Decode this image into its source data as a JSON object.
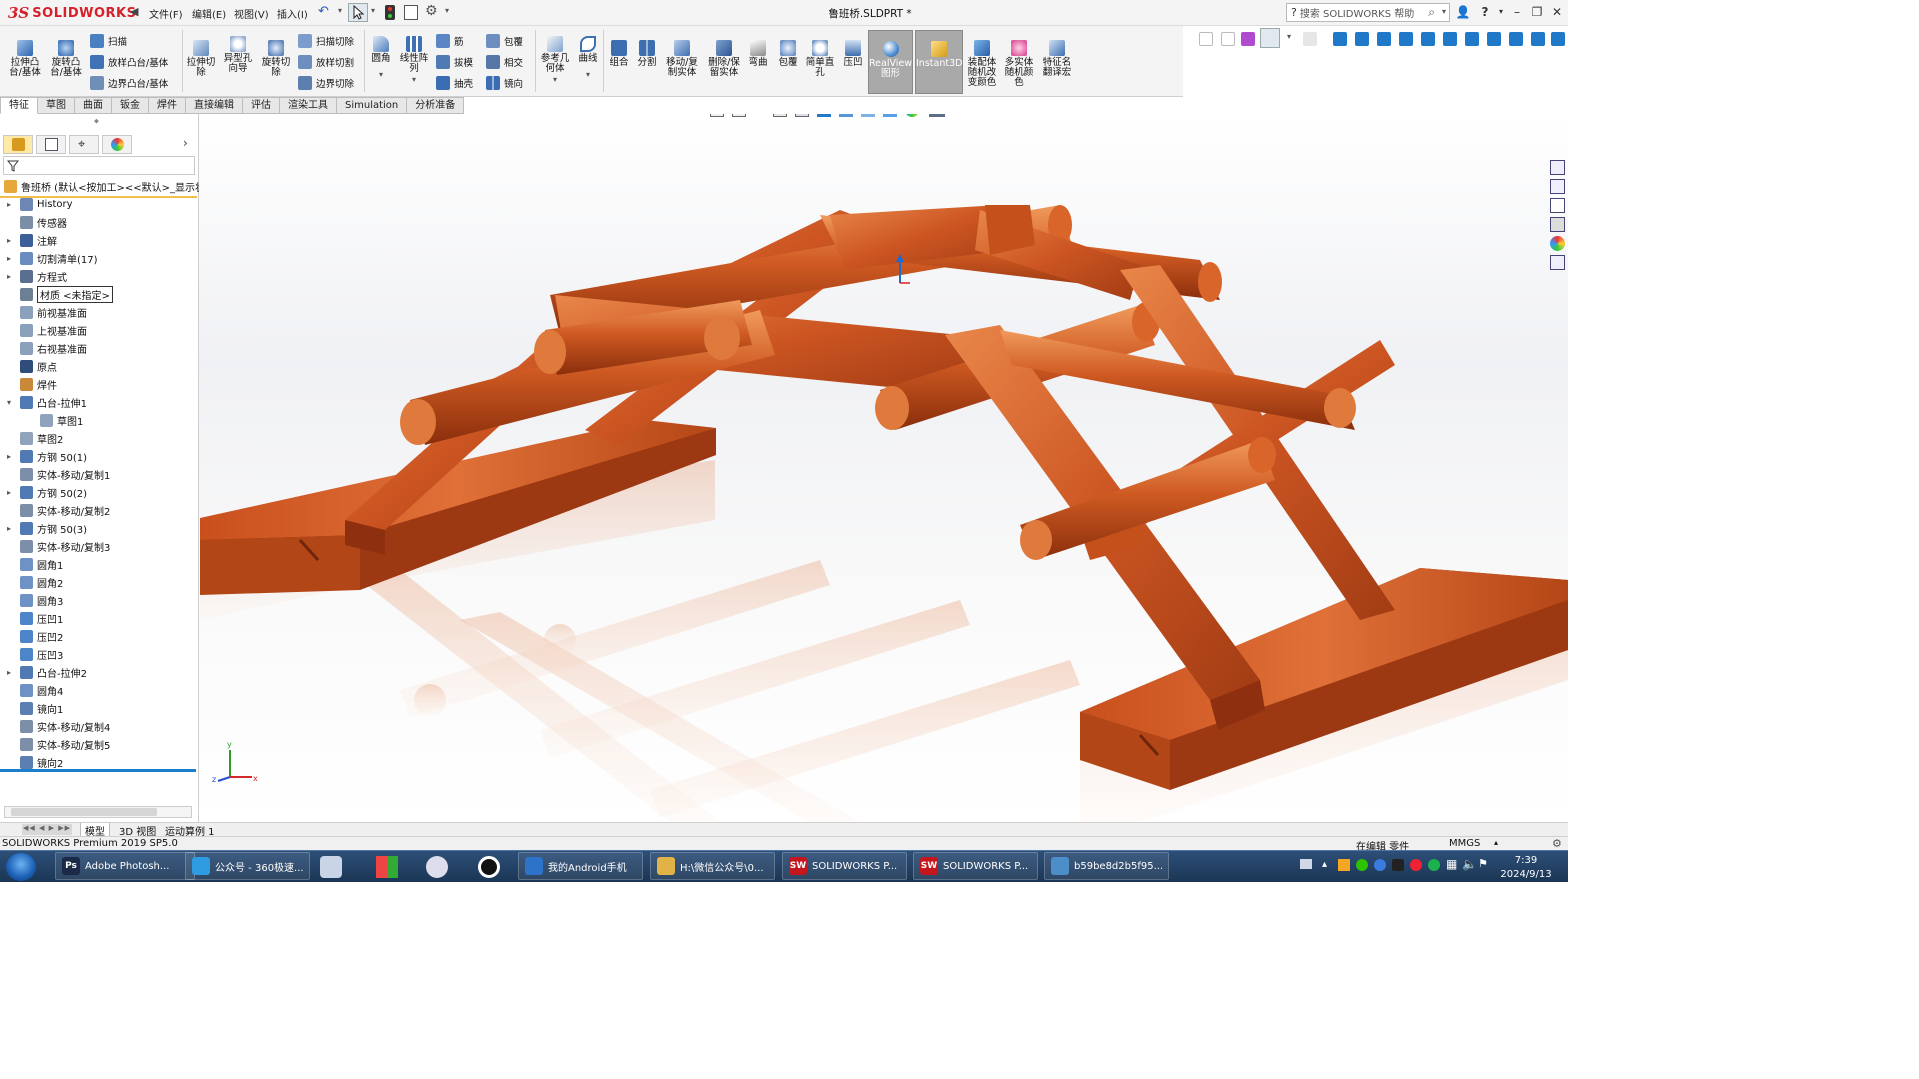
{
  "app": {
    "brand": "SOLIDWORKS",
    "doc_title": "鲁班桥.SLDPRT *"
  },
  "menu": [
    "文件(F)",
    "编辑(E)",
    "视图(V)",
    "插入(I)"
  ],
  "help": {
    "search_placeholder": "搜索 SOLIDWORKS 帮助"
  },
  "command_manager": {
    "big": [
      {
        "label": "拉伸凸\n台/基体",
        "icon": "extrude-boss-icon"
      },
      {
        "label": "旋转凸\n台/基体",
        "icon": "revolve-boss-icon"
      }
    ],
    "small_left": [
      {
        "label": "扫描",
        "icon": "sweep-icon"
      },
      {
        "label": "放样凸台/基体",
        "icon": "loft-icon"
      },
      {
        "label": "边界凸台/基体",
        "icon": "boundary-boss-icon"
      }
    ],
    "cut_big": [
      {
        "label": "拉伸切\n除",
        "icon": "extrude-cut-icon"
      },
      {
        "label": "异型孔\n向导",
        "icon": "hole-wizard-icon"
      },
      {
        "label": "旋转切\n除",
        "icon": "revolve-cut-icon"
      }
    ],
    "cut_small": [
      {
        "label": "扫描切除",
        "icon": "swept-cut-icon"
      },
      {
        "label": "放样切割",
        "icon": "lofted-cut-icon"
      },
      {
        "label": "边界切除",
        "icon": "boundary-cut-icon"
      }
    ],
    "fillet": {
      "label": "圆角",
      "icon": "fillet-icon"
    },
    "pattern": {
      "label": "线性阵\n列",
      "icon": "linear-pattern-icon"
    },
    "mid_small": [
      {
        "label": "筋",
        "icon": "rib-icon"
      },
      {
        "label": "拔模",
        "icon": "draft-icon"
      },
      {
        "label": "抽壳",
        "icon": "shell-icon"
      },
      {
        "label": "包覆",
        "icon": "wrap-icon"
      },
      {
        "label": "相交",
        "icon": "intersect-icon"
      },
      {
        "label": "镜向",
        "icon": "mirror-icon"
      }
    ],
    "right_big": [
      {
        "label": "参考几\n何体",
        "icon": "reference-geometry-icon"
      },
      {
        "label": "曲线",
        "icon": "curves-icon"
      },
      {
        "label": "组合",
        "icon": "combine-icon"
      },
      {
        "label": "分割",
        "icon": "split-icon"
      },
      {
        "label": "移动/复\n制实体",
        "icon": "move-copy-body-icon"
      },
      {
        "label": "删除/保\n留实体",
        "icon": "delete-keep-body-icon"
      },
      {
        "label": "弯曲",
        "icon": "flex-icon"
      },
      {
        "label": "包覆",
        "icon": "wrap2-icon"
      },
      {
        "label": "简单直\n孔",
        "icon": "simple-hole-icon"
      },
      {
        "label": "压凹",
        "icon": "indent-icon"
      },
      {
        "label": "RealView\n图形",
        "icon": "realview-icon"
      },
      {
        "label": "Instant3D",
        "icon": "instant3d-icon"
      },
      {
        "label": "装配体\n随机改\n变颜色",
        "icon": "random-color-icon"
      },
      {
        "label": "多实体\n随机颜\n色",
        "icon": "multibody-color-icon"
      },
      {
        "label": "特征名\n翻译宏",
        "icon": "macro-icon"
      }
    ]
  },
  "tabs": [
    "特征",
    "草图",
    "曲面",
    "钣金",
    "焊件",
    "直接编辑",
    "评估",
    "渲染工具",
    "Simulation",
    "分析准备"
  ],
  "feature_tree": {
    "root": "鲁班桥  (默认<按加工><<默认>_显示状",
    "items": [
      {
        "label": "History",
        "exp": "▸",
        "color": "#6d86b3",
        "indent": 0
      },
      {
        "label": "传感器",
        "exp": "",
        "color": "#7a8ea6",
        "indent": 0
      },
      {
        "label": "注解",
        "exp": "▸",
        "color": "#3d5f9a",
        "indent": 0
      },
      {
        "label": "切割清单(17)",
        "exp": "▸",
        "color": "#6a8cc1",
        "indent": 0
      },
      {
        "label": "方程式",
        "exp": "▸",
        "color": "#5a6f8f",
        "indent": 0
      },
      {
        "label": "材质 <未指定>",
        "exp": "",
        "color": "#6d7f92",
        "indent": 0
      },
      {
        "label": "前视基准面",
        "exp": "",
        "color": "#8aa0bb",
        "indent": 0
      },
      {
        "label": "上视基准面",
        "exp": "",
        "color": "#8aa0bb",
        "indent": 0
      },
      {
        "label": "右视基准面",
        "exp": "",
        "color": "#8aa0bb",
        "indent": 0
      },
      {
        "label": "原点",
        "exp": "",
        "color": "#2f4d7a",
        "indent": 0
      },
      {
        "label": "焊件",
        "exp": "",
        "color": "#c88a3a",
        "indent": 0
      },
      {
        "label": "凸台-拉伸1",
        "exp": "▾",
        "color": "#4f7ab4",
        "indent": 0
      },
      {
        "label": "草图1",
        "exp": "",
        "color": "#8fa3bd",
        "indent": 1
      },
      {
        "label": "草图2",
        "exp": "",
        "color": "#8fa3bd",
        "indent": 0
      },
      {
        "label": "方钢 50(1)",
        "exp": "▸",
        "color": "#4f7ab4",
        "indent": 0
      },
      {
        "label": "实体-移动/复制1",
        "exp": "",
        "color": "#7d8fa8",
        "indent": 0
      },
      {
        "label": "方钢 50(2)",
        "exp": "▸",
        "color": "#4f7ab4",
        "indent": 0
      },
      {
        "label": "实体-移动/复制2",
        "exp": "",
        "color": "#7d8fa8",
        "indent": 0
      },
      {
        "label": "方钢 50(3)",
        "exp": "▸",
        "color": "#4f7ab4",
        "indent": 0
      },
      {
        "label": "实体-移动/复制3",
        "exp": "",
        "color": "#7d8fa8",
        "indent": 0
      },
      {
        "label": "圆角1",
        "exp": "",
        "color": "#6f92c6",
        "indent": 0
      },
      {
        "label": "圆角2",
        "exp": "",
        "color": "#6f92c6",
        "indent": 0
      },
      {
        "label": "圆角3",
        "exp": "",
        "color": "#6f92c6",
        "indent": 0
      },
      {
        "label": "压凹1",
        "exp": "",
        "color": "#4c86c8",
        "indent": 0
      },
      {
        "label": "压凹2",
        "exp": "",
        "color": "#4c86c8",
        "indent": 0
      },
      {
        "label": "压凹3",
        "exp": "",
        "color": "#4c86c8",
        "indent": 0
      },
      {
        "label": "凸台-拉伸2",
        "exp": "▸",
        "color": "#4f7ab4",
        "indent": 0
      },
      {
        "label": "圆角4",
        "exp": "",
        "color": "#6f92c6",
        "indent": 0
      },
      {
        "label": "镜向1",
        "exp": "",
        "color": "#5a7fb0",
        "indent": 0
      },
      {
        "label": "实体-移动/复制4",
        "exp": "",
        "color": "#7d8fa8",
        "indent": 0
      },
      {
        "label": "实体-移动/复制5",
        "exp": "",
        "color": "#7d8fa8",
        "indent": 0
      },
      {
        "label": "镜向2",
        "exp": "",
        "color": "#5a7fb0",
        "indent": 0
      }
    ]
  },
  "bottom_tabs": [
    "模型",
    "3D 视图",
    "运动算例 1"
  ],
  "status": {
    "product": "SOLIDWORKS Premium 2019 SP5.0",
    "mode": "在编辑 零件",
    "units": "MMGS"
  },
  "taskbar": {
    "items": [
      {
        "label": "Adobe Photosh...",
        "icon": "photoshop-icon",
        "color": "#1b2a46",
        "glyph": "Ps"
      },
      {
        "label": "公众号 - 360极速...",
        "icon": "browser-icon",
        "color": "#2f9be0",
        "glyph": ""
      },
      {
        "label": "我的Android手机",
        "icon": "phone-icon",
        "color": "#2d73c9",
        "glyph": ""
      },
      {
        "label": "H:\\微信公众号\\0...",
        "icon": "folder-icon",
        "color": "#e0b248",
        "glyph": ""
      },
      {
        "label": "SOLIDWORKS P...",
        "icon": "solidworks-icon",
        "color": "#c4161c",
        "glyph": "SW"
      },
      {
        "label": "SOLIDWORKS P...",
        "icon": "solidworks-icon",
        "color": "#c4161c",
        "glyph": "SW"
      },
      {
        "label": "b59be8d2b5f95...",
        "icon": "image-viewer-icon",
        "color": "#4d8ec9",
        "glyph": ""
      }
    ],
    "clock_time": "7:39",
    "clock_date": "2024/9/13"
  },
  "colors": {
    "wood": "#c8501e",
    "wood_dark": "#8e3010",
    "wood_light": "#e57a3c",
    "accent": "#1e88c8",
    "brand": "#d6202a"
  }
}
